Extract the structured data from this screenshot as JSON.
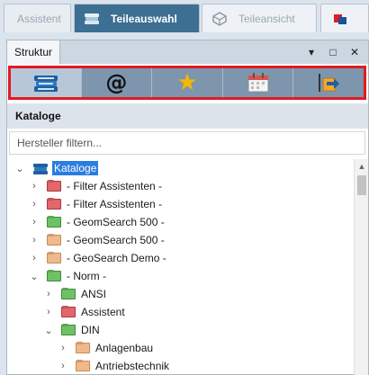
{
  "tabs": [
    {
      "label": "Assistent"
    },
    {
      "label": "Teileauswahl"
    },
    {
      "label": "Teileansicht"
    }
  ],
  "panel": {
    "title": "Struktur",
    "controls": {
      "pin": "▾",
      "maximize": "□",
      "close": "✕"
    }
  },
  "toolbar": {
    "buttons": [
      {
        "icon": "catalogs-books-icon"
      },
      {
        "icon": "at-sign-icon",
        "glyph": "@"
      },
      {
        "icon": "star-icon",
        "glyph": "★"
      },
      {
        "icon": "calendar-icon"
      },
      {
        "icon": "export-icon"
      }
    ]
  },
  "section": {
    "label": "Kataloge"
  },
  "filter": {
    "placeholder": "Hersteller filtern...",
    "value": ""
  },
  "tree": {
    "root": {
      "label": "Kataloge",
      "expanded": true,
      "selected": true
    },
    "items": [
      {
        "label": "- Filter Assistenten -",
        "color": "red",
        "level": 1,
        "expanded": false
      },
      {
        "label": "- Filter Assistenten -",
        "color": "red",
        "level": 1,
        "expanded": false
      },
      {
        "label": "- GeomSearch 500 -",
        "color": "green",
        "level": 1,
        "expanded": false
      },
      {
        "label": "- GeomSearch 500 -",
        "color": "orange",
        "level": 1,
        "expanded": false
      },
      {
        "label": "- GeoSearch Demo -",
        "color": "orange",
        "level": 1,
        "expanded": false
      },
      {
        "label": "- Norm -",
        "color": "green",
        "level": 1,
        "expanded": true
      },
      {
        "label": "ANSI",
        "color": "green",
        "level": 2,
        "expanded": false
      },
      {
        "label": "Assistent",
        "color": "red",
        "level": 2,
        "expanded": false
      },
      {
        "label": "DIN",
        "color": "green",
        "level": 2,
        "expanded": true
      },
      {
        "label": "Anlagenbau",
        "color": "orange",
        "level": 3,
        "expanded": false
      },
      {
        "label": "Antriebstechnik",
        "color": "orange",
        "level": 3,
        "expanded": false
      }
    ]
  },
  "colors": {
    "accent": "#3d6f93",
    "highlight_border": "#e11b22",
    "selection": "#2a7de1"
  }
}
